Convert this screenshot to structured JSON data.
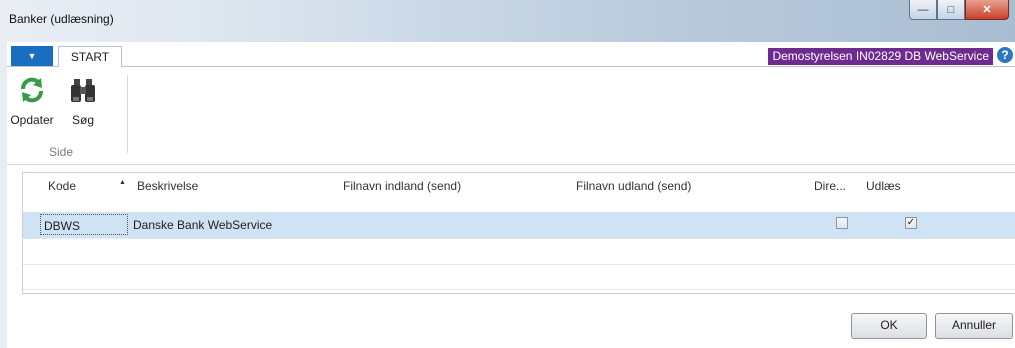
{
  "window": {
    "title": "Banker (udlæsning)",
    "minimize": "—",
    "maximize": "□",
    "close": "✕"
  },
  "ribbon": {
    "app_menu": "▼",
    "tab_start": "START",
    "company": "Demostyrelsen IN02829 DB WebService",
    "help": "?",
    "buttons": {
      "refresh": "Opdater",
      "search": "Søg"
    },
    "group": "Side"
  },
  "grid": {
    "columns": {
      "kode": "Kode",
      "beskrivelse": "Beskrivelse",
      "filnavn_indland": "Filnavn indland (send)",
      "filnavn_udland": "Filnavn udland (send)",
      "dire": "Dire...",
      "udlaes": "Udlæs"
    },
    "rows": [
      {
        "kode": "DBWS",
        "beskrivelse": "Danske Bank WebService",
        "filnavn_indland": "",
        "filnavn_udland": "",
        "dire": false,
        "udlaes": true
      }
    ]
  },
  "footer": {
    "ok": "OK",
    "cancel": "Annuller"
  },
  "colors": {
    "company_badge": "#6e2b8f",
    "selected_row": "#cfe3f4",
    "app_menu": "#1a6ec0"
  },
  "icons": [
    "refresh-icon",
    "binoculars-icon",
    "help-icon",
    "sort-ascending-icon"
  ]
}
